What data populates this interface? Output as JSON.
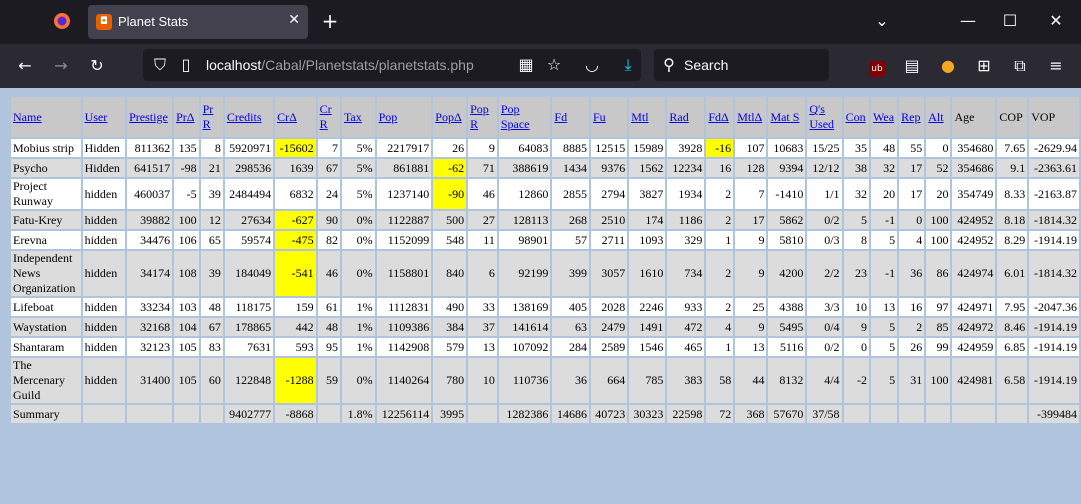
{
  "browser": {
    "tab_title": "Planet Stats",
    "url_host": "localhost",
    "url_path": "/Cabal/Planetstats/planetstats.php",
    "search_placeholder": "Search"
  },
  "table": {
    "headers": [
      {
        "label": "Name",
        "link": true
      },
      {
        "label": "User",
        "link": true
      },
      {
        "label": "Prestige",
        "link": true
      },
      {
        "label": "PrΔ",
        "link": true
      },
      {
        "label": "Pr R",
        "link": true
      },
      {
        "label": "Credits",
        "link": true
      },
      {
        "label": "CrΔ",
        "link": true
      },
      {
        "label": "Cr R",
        "link": true
      },
      {
        "label": "Tax",
        "link": true
      },
      {
        "label": "Pop",
        "link": true
      },
      {
        "label": "PopΔ",
        "link": true
      },
      {
        "label": "Pop R",
        "link": true
      },
      {
        "label": "Pop Space",
        "link": true
      },
      {
        "label": "Fd",
        "link": true
      },
      {
        "label": "Fu",
        "link": true
      },
      {
        "label": "Mtl",
        "link": true
      },
      {
        "label": "Rad",
        "link": true
      },
      {
        "label": "FdΔ",
        "link": true
      },
      {
        "label": "MtlΔ",
        "link": true
      },
      {
        "label": "Mat S",
        "link": true
      },
      {
        "label": "Q's Used",
        "link": true
      },
      {
        "label": "Con",
        "link": true
      },
      {
        "label": "Wea",
        "link": true
      },
      {
        "label": "Rep",
        "link": true
      },
      {
        "label": "Alt",
        "link": true
      },
      {
        "label": "Age",
        "link": false
      },
      {
        "label": "COP",
        "link": false
      },
      {
        "label": "VOP",
        "link": false
      }
    ],
    "rows": [
      {
        "cells": [
          "Mobius strip",
          "Hidden",
          "811362",
          "135",
          "8",
          "5920971",
          "-15602",
          "7",
          "5%",
          "2217917",
          "26",
          "9",
          "64083",
          "8885",
          "12515",
          "15989",
          "3928",
          "-16",
          "107",
          "10683",
          "15/25",
          "35",
          "48",
          "55",
          "0",
          "354680",
          "7.65",
          "-2629.94"
        ],
        "hl": [
          6,
          17
        ]
      },
      {
        "cells": [
          "Psycho",
          "Hidden",
          "641517",
          "-98",
          "21",
          "298536",
          "1639",
          "67",
          "5%",
          "861881",
          "-62",
          "71",
          "388619",
          "1434",
          "9376",
          "1562",
          "12234",
          "16",
          "128",
          "9394",
          "12/12",
          "38",
          "32",
          "17",
          "52",
          "354686",
          "9.1",
          "-2363.61"
        ],
        "hl": [
          10
        ]
      },
      {
        "cells": [
          "Project Runway",
          "hidden",
          "460037",
          "-5",
          "39",
          "2484494",
          "6832",
          "24",
          "5%",
          "1237140",
          "-90",
          "46",
          "12860",
          "2855",
          "2794",
          "3827",
          "1934",
          "2",
          "7",
          "-1410",
          "1/1",
          "32",
          "20",
          "17",
          "20",
          "354749",
          "8.33",
          "-2163.87"
        ],
        "hl": [
          10
        ]
      },
      {
        "cells": [
          "Fatu-Krey",
          "hidden",
          "39882",
          "100",
          "12",
          "27634",
          "-627",
          "90",
          "0%",
          "1122887",
          "500",
          "27",
          "128113",
          "268",
          "2510",
          "174",
          "1186",
          "2",
          "17",
          "5862",
          "0/2",
          "5",
          "-1",
          "0",
          "100",
          "424952",
          "8.18",
          "-1814.32"
        ],
        "hl": [
          6
        ]
      },
      {
        "cells": [
          "Erevna",
          "hidden",
          "34476",
          "106",
          "65",
          "59574",
          "-475",
          "82",
          "0%",
          "1152099",
          "548",
          "11",
          "98901",
          "57",
          "2711",
          "1093",
          "329",
          "1",
          "9",
          "5810",
          "0/3",
          "8",
          "5",
          "4",
          "100",
          "424952",
          "8.29",
          "-1914.19"
        ],
        "hl": [
          6
        ]
      },
      {
        "cells": [
          "Independent News Organization",
          "hidden",
          "34174",
          "108",
          "39",
          "184049",
          "-541",
          "46",
          "0%",
          "1158801",
          "840",
          "6",
          "92199",
          "399",
          "3057",
          "1610",
          "734",
          "2",
          "9",
          "4200",
          "2/2",
          "23",
          "-1",
          "36",
          "86",
          "424974",
          "6.01",
          "-1814.32"
        ],
        "hl": [
          6
        ]
      },
      {
        "cells": [
          "Lifeboat",
          "hidden",
          "33234",
          "103",
          "48",
          "118175",
          "159",
          "61",
          "1%",
          "1112831",
          "490",
          "33",
          "138169",
          "405",
          "2028",
          "2246",
          "933",
          "2",
          "25",
          "4388",
          "3/3",
          "10",
          "13",
          "16",
          "97",
          "424971",
          "7.95",
          "-2047.36"
        ],
        "hl": []
      },
      {
        "cells": [
          "Waystation",
          "hidden",
          "32168",
          "104",
          "67",
          "178865",
          "442",
          "48",
          "1%",
          "1109386",
          "384",
          "37",
          "141614",
          "63",
          "2479",
          "1491",
          "472",
          "4",
          "9",
          "5495",
          "0/4",
          "9",
          "5",
          "2",
          "85",
          "424972",
          "8.46",
          "-1914.19"
        ],
        "hl": []
      },
      {
        "cells": [
          "Shantaram",
          "hidden",
          "32123",
          "105",
          "83",
          "7631",
          "593",
          "95",
          "1%",
          "1142908",
          "579",
          "13",
          "107092",
          "284",
          "2589",
          "1546",
          "465",
          "1",
          "13",
          "5116",
          "0/2",
          "0",
          "5",
          "26",
          "99",
          "424959",
          "6.85",
          "-1914.19"
        ],
        "hl": []
      },
      {
        "cells": [
          "The Mercenary Guild",
          "hidden",
          "31400",
          "105",
          "60",
          "122848",
          "-1288",
          "59",
          "0%",
          "1140264",
          "780",
          "10",
          "110736",
          "36",
          "664",
          "785",
          "383",
          "58",
          "44",
          "8132",
          "4/4",
          "-2",
          "5",
          "31",
          "100",
          "424981",
          "6.58",
          "-1914.19"
        ],
        "hl": [
          6
        ]
      }
    ],
    "summary": [
      "Summary",
      "",
      "",
      "",
      "",
      "9402777",
      "-8868",
      "",
      "1.8%",
      "12256114",
      "3995",
      "",
      "1282386",
      "14686",
      "40723",
      "30323",
      "22598",
      "72",
      "368",
      "57670",
      "37/58",
      "",
      "",
      "",
      "",
      "",
      "",
      "-399484"
    ]
  },
  "colors": {
    "highlight": "#ffff00",
    "page_bg": "#b0c4de",
    "header_bg": "#c8c8c8",
    "link": "#0000ee"
  },
  "icons": [
    "firefox-icon",
    "tab-close-icon",
    "new-tab-icon",
    "back-icon",
    "forward-icon",
    "reload-icon",
    "shield-icon",
    "page-icon",
    "grid-icon",
    "star-icon",
    "pocket-icon",
    "download-icon",
    "search-icon",
    "ublock-icon",
    "reader-icon",
    "extension-icon",
    "puzzle-icon",
    "menu-icon"
  ]
}
